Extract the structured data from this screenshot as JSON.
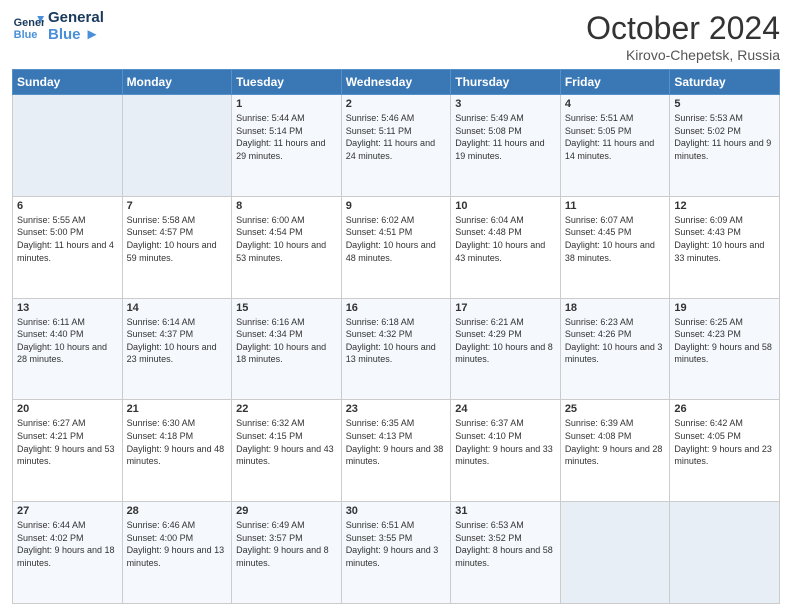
{
  "header": {
    "logo_line1": "General",
    "logo_line2": "Blue",
    "title": "October 2024",
    "subtitle": "Kirovo-Chepetsk, Russia"
  },
  "days": [
    "Sunday",
    "Monday",
    "Tuesday",
    "Wednesday",
    "Thursday",
    "Friday",
    "Saturday"
  ],
  "weeks": [
    [
      {
        "date": "",
        "info": ""
      },
      {
        "date": "",
        "info": ""
      },
      {
        "date": "1",
        "info": "Sunrise: 5:44 AM\nSunset: 5:14 PM\nDaylight: 11 hours and 29 minutes."
      },
      {
        "date": "2",
        "info": "Sunrise: 5:46 AM\nSunset: 5:11 PM\nDaylight: 11 hours and 24 minutes."
      },
      {
        "date": "3",
        "info": "Sunrise: 5:49 AM\nSunset: 5:08 PM\nDaylight: 11 hours and 19 minutes."
      },
      {
        "date": "4",
        "info": "Sunrise: 5:51 AM\nSunset: 5:05 PM\nDaylight: 11 hours and 14 minutes."
      },
      {
        "date": "5",
        "info": "Sunrise: 5:53 AM\nSunset: 5:02 PM\nDaylight: 11 hours and 9 minutes."
      }
    ],
    [
      {
        "date": "6",
        "info": "Sunrise: 5:55 AM\nSunset: 5:00 PM\nDaylight: 11 hours and 4 minutes."
      },
      {
        "date": "7",
        "info": "Sunrise: 5:58 AM\nSunset: 4:57 PM\nDaylight: 10 hours and 59 minutes."
      },
      {
        "date": "8",
        "info": "Sunrise: 6:00 AM\nSunset: 4:54 PM\nDaylight: 10 hours and 53 minutes."
      },
      {
        "date": "9",
        "info": "Sunrise: 6:02 AM\nSunset: 4:51 PM\nDaylight: 10 hours and 48 minutes."
      },
      {
        "date": "10",
        "info": "Sunrise: 6:04 AM\nSunset: 4:48 PM\nDaylight: 10 hours and 43 minutes."
      },
      {
        "date": "11",
        "info": "Sunrise: 6:07 AM\nSunset: 4:45 PM\nDaylight: 10 hours and 38 minutes."
      },
      {
        "date": "12",
        "info": "Sunrise: 6:09 AM\nSunset: 4:43 PM\nDaylight: 10 hours and 33 minutes."
      }
    ],
    [
      {
        "date": "13",
        "info": "Sunrise: 6:11 AM\nSunset: 4:40 PM\nDaylight: 10 hours and 28 minutes."
      },
      {
        "date": "14",
        "info": "Sunrise: 6:14 AM\nSunset: 4:37 PM\nDaylight: 10 hours and 23 minutes."
      },
      {
        "date": "15",
        "info": "Sunrise: 6:16 AM\nSunset: 4:34 PM\nDaylight: 10 hours and 18 minutes."
      },
      {
        "date": "16",
        "info": "Sunrise: 6:18 AM\nSunset: 4:32 PM\nDaylight: 10 hours and 13 minutes."
      },
      {
        "date": "17",
        "info": "Sunrise: 6:21 AM\nSunset: 4:29 PM\nDaylight: 10 hours and 8 minutes."
      },
      {
        "date": "18",
        "info": "Sunrise: 6:23 AM\nSunset: 4:26 PM\nDaylight: 10 hours and 3 minutes."
      },
      {
        "date": "19",
        "info": "Sunrise: 6:25 AM\nSunset: 4:23 PM\nDaylight: 9 hours and 58 minutes."
      }
    ],
    [
      {
        "date": "20",
        "info": "Sunrise: 6:27 AM\nSunset: 4:21 PM\nDaylight: 9 hours and 53 minutes."
      },
      {
        "date": "21",
        "info": "Sunrise: 6:30 AM\nSunset: 4:18 PM\nDaylight: 9 hours and 48 minutes."
      },
      {
        "date": "22",
        "info": "Sunrise: 6:32 AM\nSunset: 4:15 PM\nDaylight: 9 hours and 43 minutes."
      },
      {
        "date": "23",
        "info": "Sunrise: 6:35 AM\nSunset: 4:13 PM\nDaylight: 9 hours and 38 minutes."
      },
      {
        "date": "24",
        "info": "Sunrise: 6:37 AM\nSunset: 4:10 PM\nDaylight: 9 hours and 33 minutes."
      },
      {
        "date": "25",
        "info": "Sunrise: 6:39 AM\nSunset: 4:08 PM\nDaylight: 9 hours and 28 minutes."
      },
      {
        "date": "26",
        "info": "Sunrise: 6:42 AM\nSunset: 4:05 PM\nDaylight: 9 hours and 23 minutes."
      }
    ],
    [
      {
        "date": "27",
        "info": "Sunrise: 6:44 AM\nSunset: 4:02 PM\nDaylight: 9 hours and 18 minutes."
      },
      {
        "date": "28",
        "info": "Sunrise: 6:46 AM\nSunset: 4:00 PM\nDaylight: 9 hours and 13 minutes."
      },
      {
        "date": "29",
        "info": "Sunrise: 6:49 AM\nSunset: 3:57 PM\nDaylight: 9 hours and 8 minutes."
      },
      {
        "date": "30",
        "info": "Sunrise: 6:51 AM\nSunset: 3:55 PM\nDaylight: 9 hours and 3 minutes."
      },
      {
        "date": "31",
        "info": "Sunrise: 6:53 AM\nSunset: 3:52 PM\nDaylight: 8 hours and 58 minutes."
      },
      {
        "date": "",
        "info": ""
      },
      {
        "date": "",
        "info": ""
      }
    ]
  ]
}
